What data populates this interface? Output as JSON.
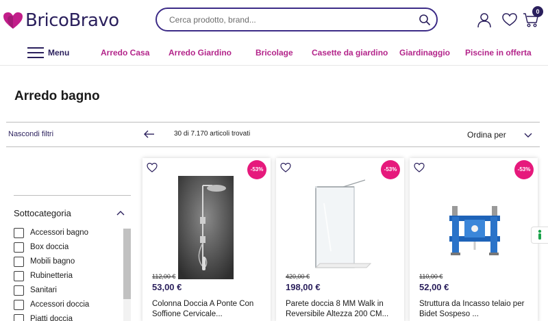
{
  "header": {
    "logo_text": "BricoBravo",
    "search_placeholder": "Cerca prodotto, brand...",
    "cart_count": "0",
    "icons": [
      "search-icon",
      "user-icon",
      "heart-icon",
      "cart-icon"
    ],
    "brand_color": "#2a1f5c",
    "accent_color": "#b3248a"
  },
  "nav": {
    "menu_label": "Menu",
    "items": [
      {
        "label": "Arredo Casa"
      },
      {
        "label": "Arredo Giardino"
      },
      {
        "label": "Bricolage"
      },
      {
        "label": "Casette da giardino"
      },
      {
        "label": "Giardinaggio"
      },
      {
        "label": "Piscine in offerta"
      }
    ]
  },
  "page": {
    "title": "Arredo bagno"
  },
  "toolbar": {
    "hide_filters": "Nascondi filtri",
    "count": "30 di 7.170 articoli trovati",
    "sort_label": "Ordina per"
  },
  "sidebar": {
    "section_title": "Sottocategoria",
    "filters": [
      {
        "label": "Accessori bagno"
      },
      {
        "label": "Box doccia"
      },
      {
        "label": "Mobili bagno"
      },
      {
        "label": "Rubinetteria"
      },
      {
        "label": "Sanitari"
      },
      {
        "label": "Accessori doccia"
      },
      {
        "label": "Piatti doccia"
      }
    ]
  },
  "products": [
    {
      "discount": "-53%",
      "old_price": "112,00 €",
      "price": "53,00 €",
      "name": "Colonna Doccia A Ponte Con Soffione Cervicale..."
    },
    {
      "discount": "-53%",
      "old_price": "420,00 €",
      "price": "198,00 €",
      "name": "Parete doccia 8 MM Walk in Reversibile Altezza 200 CM..."
    },
    {
      "discount": "-53%",
      "old_price": "110,00 €",
      "price": "52,00 €",
      "name": "Struttura da Incasso telaio per Bidet Sospeso ..."
    }
  ]
}
